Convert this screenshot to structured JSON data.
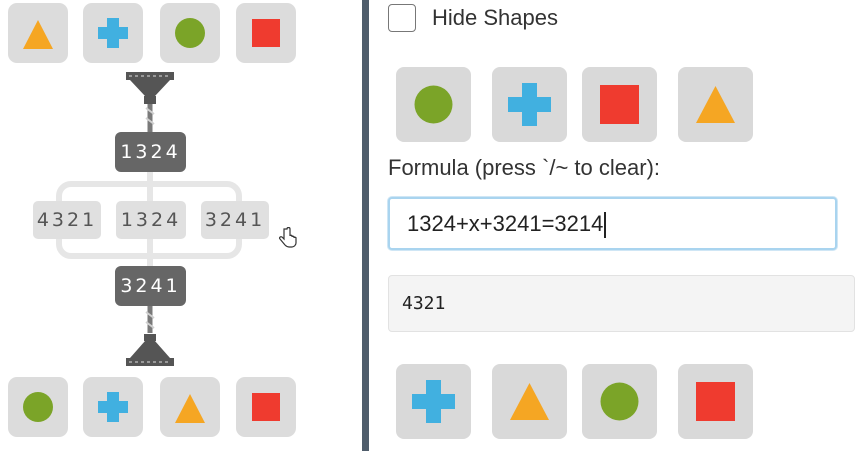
{
  "left_panel": {
    "top_row_shapes": [
      "triangle-icon",
      "plus-icon",
      "circle-icon",
      "square-icon"
    ],
    "bottom_row_shapes": [
      "circle-icon",
      "plus-icon",
      "triangle-icon",
      "square-icon"
    ],
    "top_code": "1324",
    "middle_codes": [
      "4321",
      "1324",
      "3241"
    ],
    "bottom_code": "3241"
  },
  "control_panel": {
    "hide_shapes_label": "Hide Shapes",
    "hide_shapes_checked": false,
    "top_buttons": [
      "circle-icon",
      "plus-icon",
      "square-icon",
      "triangle-icon"
    ],
    "formula_label": "Formula (press `/~ to clear):",
    "formula_value": "1324+x+3241=3214",
    "answer_value": "4321",
    "bottom_buttons": [
      "plus-icon",
      "triangle-icon",
      "circle-icon",
      "square-icon"
    ]
  },
  "colors": {
    "triangle": "#f5a623",
    "plus": "#41b0e0",
    "circle": "#7ba428",
    "square": "#ef3b2f",
    "tile_bg": "#dcdcdc",
    "divider": "#4f5d6b"
  }
}
